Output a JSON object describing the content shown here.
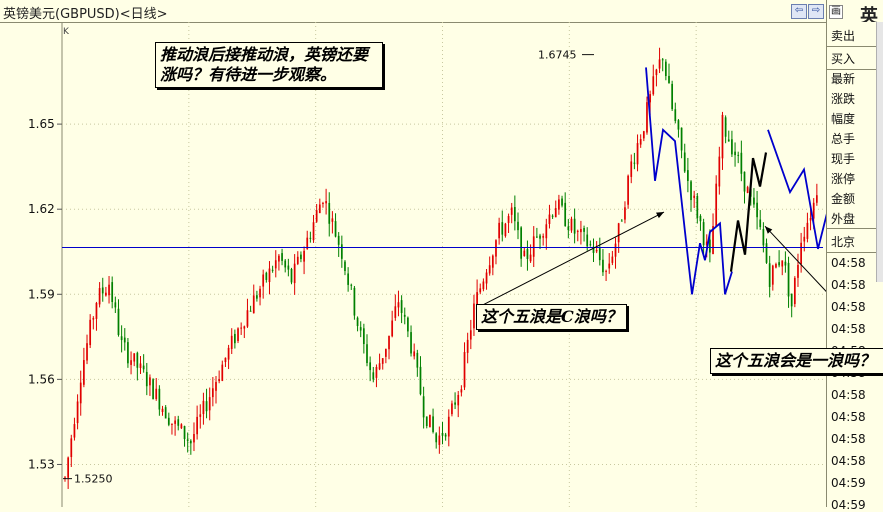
{
  "header": {
    "title": "英镑美元(GBPUSD)<日线>",
    "prev_label": "⇦",
    "next_label": "⇨"
  },
  "panel": {
    "head_big": "英",
    "head_small": "画",
    "labels": [
      "卖出",
      "买入",
      "最新",
      "涨跌",
      "幅度",
      "总手",
      "现手",
      "涨停",
      "金额",
      "外盘"
    ],
    "section": "北京",
    "times": [
      "04:58",
      "04:58",
      "04:58",
      "04:58",
      "04:58",
      "04:58",
      "04:58",
      "04:58",
      "04:58",
      "04:58",
      "04:59",
      "04:59"
    ]
  },
  "annotations": {
    "note1": "推动浪后接推动浪，英镑还要涨吗？有待进一步观察。",
    "note2": "这个五浪是C浪吗？",
    "note3": "这个五浪会是一浪吗？"
  },
  "chart_data": {
    "type": "candlestick",
    "ylim": [
      1.515,
      1.686
    ],
    "yticks": [
      "1.65",
      "1.62",
      "1.59",
      "1.56",
      "1.53"
    ],
    "ytick_values": [
      1.65,
      1.62,
      1.59,
      1.56,
      1.53
    ],
    "corner_label": "K",
    "high_label": "1.6745",
    "high_value": 1.6745,
    "low_label": "1.5250",
    "low_value": 1.525,
    "horizontal_line": 1.6065,
    "colors": {
      "up": "#E00000",
      "down": "#008000",
      "line": "#0000CC",
      "grid": "#C8C8A0"
    },
    "n_candles": 240,
    "waypoints": [
      [
        0,
        1.525
      ],
      [
        5,
        1.562
      ],
      [
        10,
        1.588
      ],
      [
        14,
        1.594
      ],
      [
        18,
        1.572
      ],
      [
        26,
        1.56
      ],
      [
        34,
        1.545
      ],
      [
        40,
        1.538
      ],
      [
        48,
        1.56
      ],
      [
        56,
        1.58
      ],
      [
        62,
        1.592
      ],
      [
        68,
        1.603
      ],
      [
        72,
        1.595
      ],
      [
        78,
        1.612
      ],
      [
        82,
        1.625
      ],
      [
        88,
        1.605
      ],
      [
        94,
        1.575
      ],
      [
        98,
        1.56
      ],
      [
        103,
        1.575
      ],
      [
        106,
        1.588
      ],
      [
        110,
        1.572
      ],
      [
        114,
        1.55
      ],
      [
        118,
        1.538
      ],
      [
        122,
        1.545
      ],
      [
        126,
        1.56
      ],
      [
        130,
        1.585
      ],
      [
        134,
        1.6
      ],
      [
        138,
        1.612
      ],
      [
        142,
        1.618
      ],
      [
        146,
        1.602
      ],
      [
        150,
        1.61
      ],
      [
        156,
        1.622
      ],
      [
        162,
        1.612
      ],
      [
        168,
        1.606
      ],
      [
        172,
        1.598
      ],
      [
        176,
        1.612
      ],
      [
        180,
        1.636
      ],
      [
        184,
        1.65
      ],
      [
        188,
        1.668
      ],
      [
        190,
        1.6745
      ],
      [
        193,
        1.655
      ],
      [
        198,
        1.63
      ],
      [
        202,
        1.615
      ],
      [
        205,
        1.602
      ],
      [
        209,
        1.65
      ],
      [
        213,
        1.64
      ],
      [
        217,
        1.626
      ],
      [
        221,
        1.612
      ],
      [
        224,
        1.596
      ],
      [
        228,
        1.604
      ],
      [
        231,
        1.586
      ],
      [
        234,
        1.61
      ],
      [
        238,
        1.622
      ],
      [
        242,
        1.644
      ],
      [
        244,
        1.632
      ],
      [
        246,
        1.65
      ],
      [
        248,
        1.642
      ]
    ],
    "wave_lines": [
      {
        "name": "wave_blue_1",
        "points": [
          [
            646,
            1.67
          ],
          [
            655,
            1.63
          ],
          [
            663,
            1.648
          ],
          [
            675,
            1.644
          ],
          [
            685,
            1.612
          ],
          [
            692,
            1.59
          ],
          [
            700,
            1.608
          ],
          [
            705,
            1.602
          ],
          [
            710,
            1.612
          ],
          [
            720,
            1.615
          ],
          [
            725,
            1.59
          ],
          [
            732,
            1.598
          ]
        ]
      },
      {
        "name": "wave_blue_2",
        "points": [
          [
            768,
            1.648
          ],
          [
            790,
            1.626
          ],
          [
            804,
            1.634
          ],
          [
            818,
            1.606
          ],
          [
            828,
            1.62
          ],
          [
            846,
            1.645
          ],
          [
            860,
            1.66
          ]
        ]
      },
      {
        "name": "wave_black",
        "points": [
          [
            731,
            1.598
          ],
          [
            738,
            1.616
          ],
          [
            745,
            1.604
          ],
          [
            753,
            1.638
          ],
          [
            760,
            1.628
          ],
          [
            766,
            1.64
          ]
        ]
      }
    ],
    "arrows": [
      {
        "from": [
          476,
          1.585
        ],
        "to": [
          664,
          1.619
        ]
      },
      {
        "from": [
          882,
          1.57
        ],
        "to": [
          765,
          1.614
        ]
      }
    ]
  }
}
